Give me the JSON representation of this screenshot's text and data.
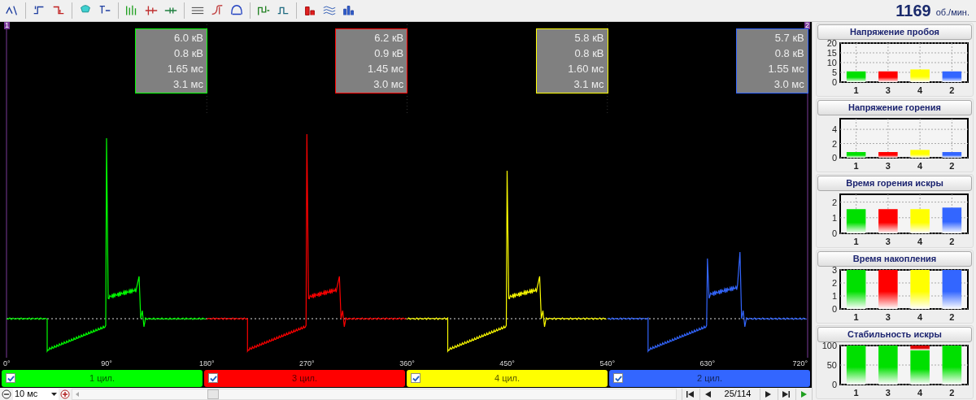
{
  "toolbar": {
    "rpm": "1169",
    "rpm_unit": "об./мин."
  },
  "scope": {
    "markers": [
      "1",
      "2"
    ],
    "angle_ticks": [
      "0°",
      "90°",
      "180°",
      "270°",
      "360°",
      "450°",
      "540°",
      "630°",
      "720°"
    ],
    "cylinders": [
      {
        "label": "1 цил.",
        "checked": true,
        "color": "#00ff00",
        "readings": [
          "6.0 кВ",
          "0.8 кВ",
          "1.65 мс",
          "3.1 мс"
        ]
      },
      {
        "label": "3 цил.",
        "checked": true,
        "color": "#ff0000",
        "readings": [
          "6.2 кВ",
          "0.9 кВ",
          "1.45 мс",
          "3.0 мс"
        ]
      },
      {
        "label": "4 цил.",
        "checked": true,
        "color": "#ffff00",
        "readings": [
          "5.8 кВ",
          "0.8 кВ",
          "1.60 мс",
          "3.1 мс"
        ]
      },
      {
        "label": "2 цил.",
        "checked": true,
        "color": "#3366ff",
        "readings": [
          "5.7 кВ",
          "0.8 кВ",
          "1.55 мс",
          "3.0 мс"
        ]
      }
    ]
  },
  "bottom_bar": {
    "time_scale": "10 мс",
    "frame": "25/114"
  },
  "charts": [
    {
      "title": "Напряжение пробоя",
      "chart_data": {
        "type": "bar",
        "grid": true,
        "categories": [
          "1",
          "3",
          "4",
          "2"
        ],
        "stacked": true,
        "ylim": [
          0,
          20
        ],
        "yticks": [
          0,
          5,
          10,
          15,
          20
        ],
        "series": [
          {
            "color": "#00e000",
            "values": [
              5.5,
              null,
              null,
              null
            ]
          },
          {
            "color": "#ff0000",
            "values": [
              null,
              5.5,
              null,
              null
            ]
          },
          {
            "color": "#ffff00",
            "values": [
              null,
              null,
              6.5,
              null
            ]
          },
          {
            "color": "#3366ff",
            "values": [
              null,
              null,
              null,
              5.5
            ]
          }
        ]
      }
    },
    {
      "title": "Напряжение горения",
      "chart_data": {
        "type": "bar",
        "grid": true,
        "categories": [
          "1",
          "3",
          "4",
          "2"
        ],
        "stacked": true,
        "ylim": [
          0,
          5.5
        ],
        "yticks": [
          0,
          2,
          4
        ],
        "series": [
          {
            "color": "#00e000",
            "values": [
              0.8,
              null,
              null,
              null
            ]
          },
          {
            "color": "#ff0000",
            "values": [
              null,
              0.8,
              null,
              null
            ]
          },
          {
            "color": "#ffff00",
            "values": [
              null,
              null,
              1.1,
              null
            ]
          },
          {
            "color": "#3366ff",
            "values": [
              null,
              null,
              null,
              0.8
            ]
          }
        ]
      }
    },
    {
      "title": "Время горения искры",
      "chart_data": {
        "type": "bar",
        "grid": true,
        "categories": [
          "1",
          "3",
          "4",
          "2"
        ],
        "stacked": true,
        "ylim": [
          0,
          2.5
        ],
        "yticks": [
          0,
          1,
          2
        ],
        "series": [
          {
            "color": "#00e000",
            "values": [
              1.55,
              null,
              null,
              null
            ]
          },
          {
            "color": "#ff0000",
            "values": [
              null,
              1.55,
              null,
              null
            ]
          },
          {
            "color": "#ffff00",
            "values": [
              null,
              null,
              1.55,
              null
            ]
          },
          {
            "color": "#3366ff",
            "values": [
              null,
              null,
              null,
              1.65
            ]
          }
        ]
      }
    },
    {
      "title": "Время накопления",
      "chart_data": {
        "type": "bar",
        "grid": true,
        "categories": [
          "1",
          "3",
          "4",
          "2"
        ],
        "stacked": true,
        "ylim": [
          0,
          3
        ],
        "yticks": [
          0,
          1,
          2,
          3
        ],
        "series": [
          {
            "color": "#00e000",
            "values": [
              3.0,
              null,
              null,
              null
            ]
          },
          {
            "color": "#ff0000",
            "values": [
              null,
              3.0,
              null,
              null
            ]
          },
          {
            "color": "#ffff00",
            "values": [
              null,
              null,
              3.0,
              null
            ]
          },
          {
            "color": "#3366ff",
            "values": [
              null,
              null,
              null,
              3.0
            ]
          }
        ]
      }
    },
    {
      "title": "Стабильность искры",
      "chart_data": {
        "type": "bar",
        "grid": true,
        "categories": [
          "1",
          "3",
          "4",
          "2"
        ],
        "stacked": true,
        "ylim": [
          0,
          100
        ],
        "yticks": [
          0,
          50,
          100
        ],
        "series": [
          {
            "color": "#00e000",
            "values": [
              100,
              100,
              88,
              100
            ]
          },
          {
            "color": "#dd0000",
            "values": [
              null,
              null,
              12,
              null
            ]
          }
        ]
      }
    }
  ]
}
